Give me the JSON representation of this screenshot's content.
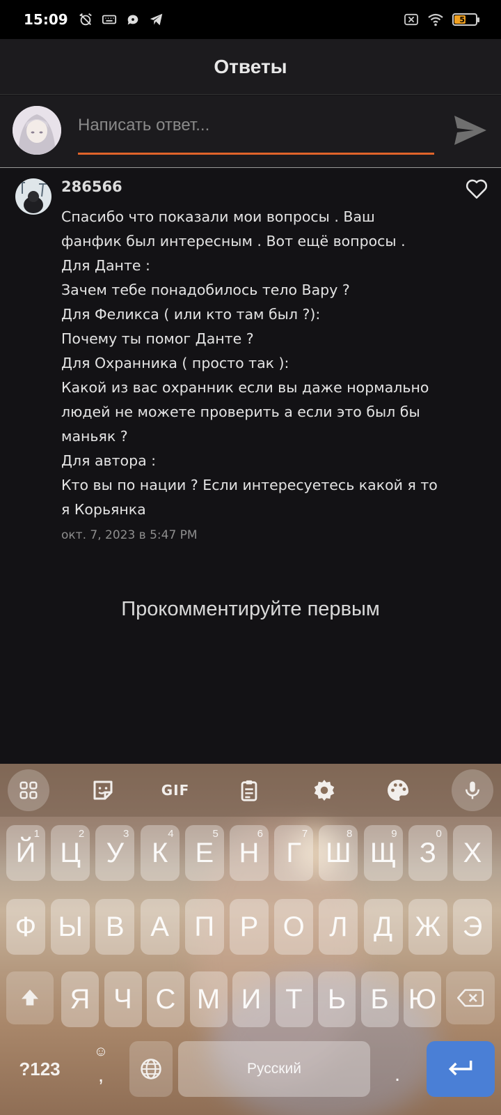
{
  "status_bar": {
    "time": "15:09",
    "battery": "53",
    "battery_level": 0.53
  },
  "header": {
    "title": "Ответы"
  },
  "composer": {
    "placeholder": "Написать ответ...",
    "accent_color": "#e0642a"
  },
  "comment": {
    "author": "286566",
    "lines": [
      "Спасибо что показали мои вопросы . Ваш",
      "фанфик был интересным . Вот ещё вопросы .",
      "Для Данте :",
      "Зачем тебе понадобилось тело Вару ?",
      "Для Феликса ( или кто там был ?):",
      "Почему ты помог Данте ?",
      "Для Охранника ( просто так ):",
      "Какой из вас охранник если вы даже нормально",
      "людей не можете  проверить а если это был бы",
      "маньяк ?",
      "Для автора :",
      "Кто вы по нации ? Если интересуетесь какой я то",
      "я Корьянка"
    ],
    "date": "окт. 7, 2023 в 5:47 PM"
  },
  "empty_message": "Прокомментируйте первым",
  "keyboard": {
    "toolbar": {
      "gif": "GIF",
      "icons": [
        "apps-grid-icon",
        "sticker-icon",
        "gif-icon",
        "clipboard-icon",
        "settings-icon",
        "palette-icon",
        "microphone-icon"
      ]
    },
    "row1": [
      {
        "key": "Й",
        "hint": "1"
      },
      {
        "key": "Ц",
        "hint": "2"
      },
      {
        "key": "У",
        "hint": "3"
      },
      {
        "key": "К",
        "hint": "4"
      },
      {
        "key": "Е",
        "hint": "5"
      },
      {
        "key": "Н",
        "hint": "6"
      },
      {
        "key": "Г",
        "hint": "7"
      },
      {
        "key": "Ш",
        "hint": "8"
      },
      {
        "key": "Щ",
        "hint": "9"
      },
      {
        "key": "З",
        "hint": "0"
      },
      {
        "key": "Х",
        "hint": ""
      }
    ],
    "row2": [
      "Ф",
      "Ы",
      "В",
      "А",
      "П",
      "Р",
      "О",
      "Л",
      "Д",
      "Ж",
      "Э"
    ],
    "row3": [
      "Я",
      "Ч",
      "С",
      "М",
      "И",
      "Т",
      "Ь",
      "Б",
      "Ю"
    ],
    "symbols": "?123",
    "comma": ",",
    "space": "Русский",
    "period": "."
  }
}
